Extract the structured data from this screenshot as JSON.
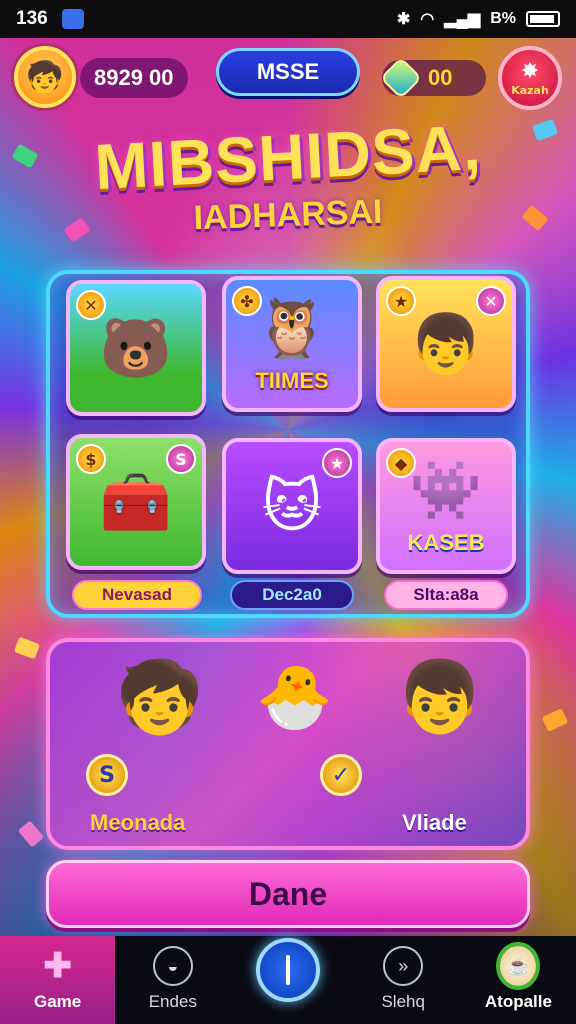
{
  "status_bar": {
    "time": "136",
    "battery": "В%"
  },
  "hud": {
    "coins": "8929 00",
    "mode": "MSSE",
    "gems": "00",
    "store_label": "Kazah"
  },
  "title": "MIBSHIDSA,",
  "subtitle": "IADHARSAI",
  "grid": {
    "tiles": [
      {
        "name": "tile-bear",
        "text": ""
      },
      {
        "name": "tile-owl",
        "text": "TIIMES"
      },
      {
        "name": "tile-boy",
        "text": ""
      },
      {
        "name": "tile-chest",
        "text": ""
      },
      {
        "name": "tile-cat",
        "text": ""
      },
      {
        "name": "tile-blob",
        "text": "KASEB"
      }
    ],
    "labels": [
      "Nevasad",
      "Dec2a0",
      "Slta:a8a"
    ]
  },
  "feature": {
    "left_label": "Meonada",
    "right_label": "Vliade",
    "coin1": "S",
    "coin2": "✓"
  },
  "cta_label": "Dane",
  "nav": [
    {
      "label": "Game",
      "icon": "puzzle-icon"
    },
    {
      "label": "Endes",
      "icon": "search-icon"
    },
    {
      "label": "",
      "icon": "play-icon"
    },
    {
      "label": "Slehq",
      "icon": "forward-icon"
    },
    {
      "label": "Atopalle",
      "icon": "cup-icon"
    }
  ],
  "colors": {
    "accent_pink": "#e12ab8",
    "panel_border": "#4fd8ff",
    "gold_text": "#ffd33a",
    "nav_active": "#d5288f"
  }
}
